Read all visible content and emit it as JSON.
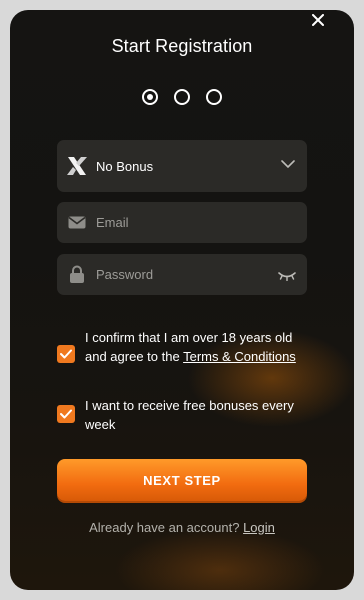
{
  "header": {
    "title": "Start Registration",
    "close_icon": "close-icon"
  },
  "steps": {
    "total": 3,
    "current": 1
  },
  "form": {
    "bonus": {
      "value": "No Bonus",
      "icon": "x-logo-icon"
    },
    "email": {
      "placeholder": "Email",
      "icon": "mail-icon"
    },
    "password": {
      "placeholder": "Password",
      "icon": "lock-icon"
    }
  },
  "checkboxes": {
    "age": {
      "checked": true,
      "text": "I confirm that I am over 18 years old and agree to the",
      "link": "Terms & Conditions"
    },
    "bonuses": {
      "checked": true,
      "text": "I want to receive free bonuses every week"
    }
  },
  "buttons": {
    "next": "NEXT STEP"
  },
  "footer": {
    "prompt": "Already have an account?",
    "link": "Login"
  },
  "colors": {
    "accent": "#f0791f",
    "field_bg": "#2b2a27",
    "background": "#151412"
  }
}
